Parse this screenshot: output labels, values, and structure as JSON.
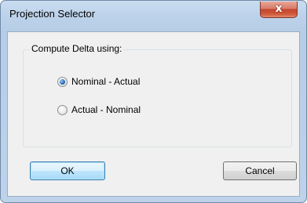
{
  "window": {
    "title": "Projection Selector",
    "close_glyph": "x"
  },
  "group": {
    "label": "Compute Delta using:",
    "options": [
      {
        "label": "Nominal - Actual",
        "selected": true
      },
      {
        "label": "Actual - Nominal",
        "selected": false
      }
    ]
  },
  "buttons": {
    "ok_label": "OK",
    "cancel_label": "Cancel"
  },
  "colors": {
    "accent": "#2a6fb8",
    "close_red": "#c4442d",
    "titlebar": "#bcd2ea"
  }
}
